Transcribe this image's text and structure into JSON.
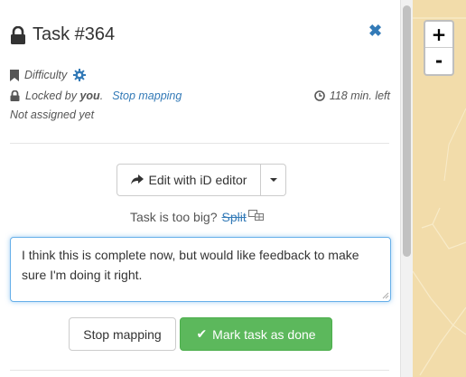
{
  "task": {
    "title": "Task #364",
    "close_symbol": "✖"
  },
  "meta": {
    "difficulty_label": "Difficulty",
    "locked_prefix": "Locked by",
    "locked_user": "you",
    "locked_suffix": ".",
    "stop_mapping_link": "Stop mapping",
    "time_left": "118 min. left",
    "assignment": "Not assigned yet"
  },
  "editor": {
    "edit_button_label": "Edit with iD editor"
  },
  "split": {
    "prefix": "Task is too big?",
    "link": "Split"
  },
  "comment": {
    "value": "I think this is complete now, but would like feedback to make sure I'm doing it right."
  },
  "actions": {
    "stop_mapping_label": "Stop mapping",
    "mark_done_label": "Mark task as done",
    "mark_done_check": "✔"
  },
  "map": {
    "zoom_in": "+",
    "zoom_out": "-"
  },
  "icons": [
    "lock-icon",
    "bookmark-icon",
    "gear-icon",
    "small-lock-icon",
    "clock-icon",
    "share-arrow-icon",
    "split-grid-icon",
    "check-icon",
    "close-icon"
  ],
  "colors": {
    "link": "#337ab7",
    "success": "#5cb85c",
    "map_background": "#f2dcaa"
  }
}
